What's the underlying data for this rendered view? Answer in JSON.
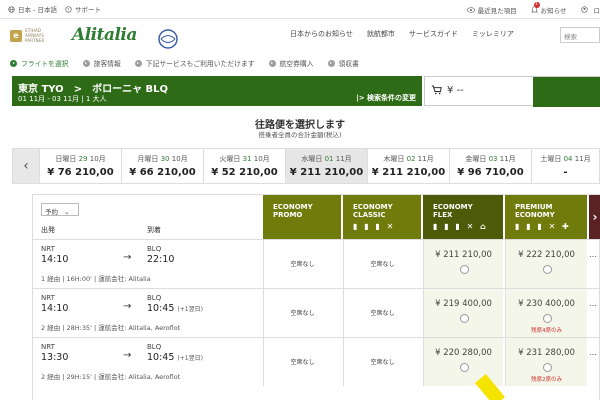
{
  "topbar": {
    "language": "日本 - 日本語",
    "support": "サポート",
    "recent": "最近見た項目",
    "notifications": "お知らせ",
    "notif_count": "1",
    "login": "ロ"
  },
  "header": {
    "etihad_lines": "ETIHAD AIRWAYS PARTNER",
    "alitalia": "Alitalia",
    "nav": [
      "日本からのお知らせ",
      "就航都市",
      "サービスガイド",
      "ミッレミリア"
    ],
    "search_placeholder": "検索"
  },
  "steps": [
    "フライトを選択",
    "旅客情報",
    "下記サービスもご利用いただけます",
    "航空券購入",
    "領収書"
  ],
  "route": {
    "title": "東京 TYO　>　ボローニャ BLQ",
    "dates": "01 11月 - 03 11月 | 1 大人",
    "modify": "|> 検索条件の変更"
  },
  "cart": {
    "price": "¥ --"
  },
  "outbound": {
    "title": "往路便を選択します",
    "subtitle": "搭乗者全員の合計金額(税込)"
  },
  "dates": [
    {
      "day": "日曜日",
      "num": "29",
      "month": "10月",
      "price": "¥ 76 210,00",
      "selected": false
    },
    {
      "day": "月曜日",
      "num": "30",
      "month": "10月",
      "price": "¥ 66 210,00",
      "selected": false
    },
    {
      "day": "火曜日",
      "num": "31",
      "month": "10月",
      "price": "¥ 52 210,00",
      "selected": false
    },
    {
      "day": "水曜日",
      "num": "01",
      "month": "11月",
      "price": "¥ 211 210,00",
      "selected": true
    },
    {
      "day": "木曜日",
      "num": "02",
      "month": "11月",
      "price": "¥ 211 210,00",
      "selected": false
    },
    {
      "day": "金曜日",
      "num": "03",
      "month": "11月",
      "price": "¥ 96 710,00",
      "selected": false
    },
    {
      "day": "土曜日",
      "num": "04",
      "month": "11月",
      "price": "-",
      "selected": false
    }
  ],
  "table": {
    "sort_label": "予約",
    "col_dep": "出発",
    "col_arr": "到着",
    "fares": [
      {
        "line1": "ECONOMY",
        "line2": "PROMO",
        "icons": ""
      },
      {
        "line1": "ECONOMY",
        "line2": "CLASSIC",
        "icons": "▮ ▮ ▮ ✕"
      },
      {
        "line1": "ECONOMY",
        "line2": "FLEX",
        "icons": "▮ ▮ ▮ ✕ ⌂"
      },
      {
        "line1": "PREMIUM",
        "line2": "ECONOMY",
        "icons": "▮ ▮ ▮ ✕ ✚"
      }
    ],
    "rows": [
      {
        "dep_code": "NRT",
        "dep_time": "14:10",
        "arr_code": "BLQ",
        "arr_time": "22:10",
        "plus": "",
        "info": "1 経由 | 16H:00' | 運航会社: Alitalia",
        "cells": [
          {
            "type": "na",
            "text": "空席なし"
          },
          {
            "type": "na",
            "text": "空席なし"
          },
          {
            "type": "price",
            "text": "¥ 211 210,00",
            "warn": ""
          },
          {
            "type": "price",
            "text": "¥ 222 210,00",
            "warn": ""
          }
        ]
      },
      {
        "dep_code": "NRT",
        "dep_time": "14:10",
        "arr_code": "BLQ",
        "arr_time": "10:45",
        "plus": "(+1翌日)",
        "info": "2 経由 | 28H:35' | 運航会社: Alitalia, Aeroflot",
        "cells": [
          {
            "type": "na",
            "text": "空席なし"
          },
          {
            "type": "na",
            "text": "空席なし"
          },
          {
            "type": "price",
            "text": "¥ 219 400,00",
            "warn": ""
          },
          {
            "type": "price",
            "text": "¥ 230 400,00",
            "warn": "残席4席のみ"
          }
        ]
      },
      {
        "dep_code": "NRT",
        "dep_time": "13:30",
        "arr_code": "BLQ",
        "arr_time": "10:45",
        "plus": "(+1翌日)",
        "info": "2 経由 | 29H:15' | 運航会社: Alitalia, Aeroflot",
        "cells": [
          {
            "type": "na",
            "text": "空席なし"
          },
          {
            "type": "na",
            "text": "空席なし"
          },
          {
            "type": "price",
            "text": "¥ 220 280,00",
            "warn": ""
          },
          {
            "type": "price",
            "text": "¥ 231 280,00",
            "warn": "残席2席のみ"
          }
        ]
      }
    ]
  }
}
